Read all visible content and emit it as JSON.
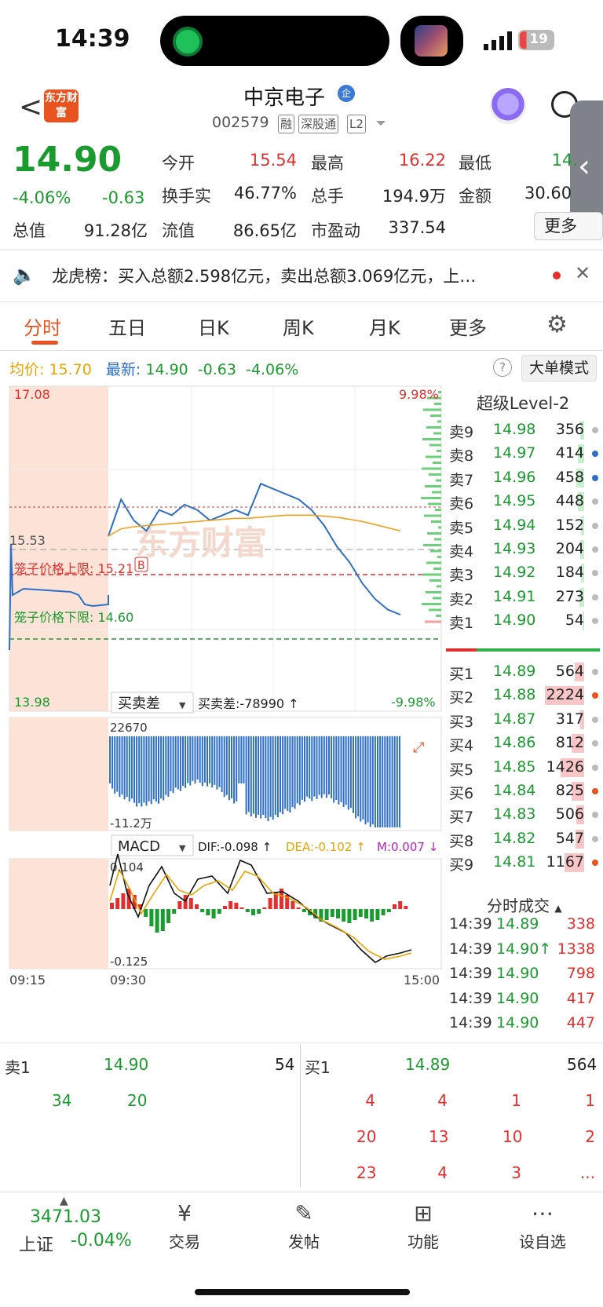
{
  "status_bar": {
    "time": "14:39",
    "battery": "19"
  },
  "header": {
    "back_label": "<",
    "logo_text": "东方财富",
    "stock_name": "中京电子",
    "qi_badge": "企",
    "stock_code": "002579",
    "tags": [
      "融",
      "深股通",
      "L2"
    ]
  },
  "quote": {
    "price": "14.90",
    "change_pct": "-4.06%",
    "change": "-0.63",
    "fields": [
      {
        "label": "今开",
        "value": "15.54",
        "color": "red"
      },
      {
        "label": "最高",
        "value": "16.22",
        "color": "red"
      },
      {
        "label": "最低",
        "value": "14.",
        "color": "green"
      },
      {
        "label": "换手实",
        "value": "46.77%",
        "color": "dark"
      },
      {
        "label": "总手",
        "value": "194.9万",
        "color": "dark"
      },
      {
        "label": "金额",
        "value": "30.60",
        "color": "dark"
      },
      {
        "label": "总值",
        "value": "91.28亿",
        "color": "dark"
      },
      {
        "label": "流值",
        "value": "86.65亿",
        "color": "dark"
      },
      {
        "label": "市盈动",
        "value": "337.54",
        "color": "dark"
      }
    ],
    "more_label": "更多"
  },
  "notice": {
    "text": "龙虎榜：买入总额2.598亿元，卖出总额3.069亿元，上…"
  },
  "tabs": [
    "分时",
    "五日",
    "日K",
    "周K",
    "月K",
    "更多"
  ],
  "info_line": {
    "avg_label": "均价:",
    "avg_value": "15.70",
    "latest_label": "最新:",
    "latest_value": "14.90",
    "change": "-0.63",
    "change_pct": "-4.06%",
    "mode_button": "大单模式"
  },
  "chart": {
    "y_high": "17.08",
    "y_low": "13.98",
    "y_mid": "15.53",
    "pct_high": "9.98%",
    "pct_low": "-9.98%",
    "upper_limit_label": "笼子价格上限: 15.21",
    "lower_limit_label": "笼子价格下限: 14.60",
    "marker": "B",
    "watermark": "东方财富",
    "buy_sell_diff_title": "买卖差",
    "buy_sell_diff_value": "买卖差:-78990 ↑",
    "diff_high": "22670",
    "diff_low": "-11.2万",
    "macd_title": "MACD",
    "dif": "DIF:-0.098 ↑",
    "dea": "DEA:-0.102 ↑",
    "m": "M:0.007 ↓",
    "macd_high": "0.104",
    "macd_low": "-0.125",
    "time_labels": [
      "09:15",
      "09:30",
      "15:00"
    ],
    "colors": {
      "price_line": "#2d6fc6",
      "avg_line": "#f0a020",
      "up": "#e52e2e",
      "down": "#1a9b2f"
    }
  },
  "chart_data": {
    "type": "line",
    "title": "",
    "ylim": [
      13.98,
      17.08
    ],
    "x": [
      "09:30",
      "15:00"
    ],
    "series": [
      {
        "name": "",
        "values": [
          15.65,
          16.0,
          15.8,
          15.7,
          15.9,
          15.85,
          15.95,
          15.9,
          15.8,
          15.85,
          15.9,
          15.85,
          16.15,
          16.1,
          16.05,
          16.0,
          15.9,
          15.75,
          15.55,
          15.4,
          15.2,
          15.05,
          14.95,
          14.9
        ]
      },
      {
        "name": "",
        "values": [
          15.65,
          15.72,
          15.74,
          15.75,
          15.76,
          15.77,
          15.78,
          15.79,
          15.8,
          15.81,
          15.82,
          15.82,
          15.83,
          15.84,
          15.85,
          15.85,
          15.85,
          15.84,
          15.83,
          15.81,
          15.79,
          15.76,
          15.73,
          15.7
        ]
      }
    ]
  },
  "level2": {
    "title": "超级Level-2",
    "asks": [
      {
        "label": "卖9",
        "price": "14.98",
        "vol": "356",
        "bar": 0.05,
        "dot": "#bbb"
      },
      {
        "label": "卖8",
        "price": "14.97",
        "vol": "414",
        "bar": 0.08,
        "dot": "#2d6fc6"
      },
      {
        "label": "卖7",
        "price": "14.96",
        "vol": "458",
        "bar": 0.1,
        "dot": "#2d6fc6"
      },
      {
        "label": "卖6",
        "price": "14.95",
        "vol": "448",
        "bar": 0.08,
        "dot": "#bbb"
      },
      {
        "label": "卖5",
        "price": "14.94",
        "vol": "152",
        "bar": 0.04,
        "dot": "#bbb"
      },
      {
        "label": "卖4",
        "price": "14.93",
        "vol": "204",
        "bar": 0.05,
        "dot": "#bbb"
      },
      {
        "label": "卖3",
        "price": "14.92",
        "vol": "184",
        "bar": 0.04,
        "dot": "#bbb"
      },
      {
        "label": "卖2",
        "price": "14.91",
        "vol": "273",
        "bar": 0.06,
        "dot": "#bbb"
      },
      {
        "label": "卖1",
        "price": "14.90",
        "vol": "54",
        "bar": 0.02,
        "dot": "#bbb"
      }
    ],
    "bids": [
      {
        "label": "买1",
        "price": "14.89",
        "vol": "564",
        "bar": 0.12,
        "dot": "#bbb"
      },
      {
        "label": "买2",
        "price": "14.88",
        "vol": "2224",
        "bar": 0.5,
        "dot": "#e8531f"
      },
      {
        "label": "买3",
        "price": "14.87",
        "vol": "317",
        "bar": 0.05,
        "dot": "#bbb"
      },
      {
        "label": "买4",
        "price": "14.86",
        "vol": "812",
        "bar": 0.16,
        "dot": "#bbb"
      },
      {
        "label": "买5",
        "price": "14.85",
        "vol": "1426",
        "bar": 0.3,
        "dot": "#bbb"
      },
      {
        "label": "买6",
        "price": "14.84",
        "vol": "825",
        "bar": 0.16,
        "dot": "#e8531f"
      },
      {
        "label": "买7",
        "price": "14.83",
        "vol": "506",
        "bar": 0.1,
        "dot": "#bbb"
      },
      {
        "label": "买8",
        "price": "14.82",
        "vol": "547",
        "bar": 0.11,
        "dot": "#bbb"
      },
      {
        "label": "买9",
        "price": "14.81",
        "vol": "1167",
        "bar": 0.25,
        "dot": "#e8531f"
      }
    ],
    "ticks_title": "分时成交",
    "ticks": [
      {
        "time": "14:39",
        "price": "14.89",
        "vol": "338",
        "color": "green"
      },
      {
        "time": "14:39",
        "price": "14.90↑",
        "vol": "1338",
        "color": "red"
      },
      {
        "time": "14:39",
        "price": "14.90",
        "vol": "798",
        "color": "green"
      },
      {
        "time": "14:39",
        "price": "14.90",
        "vol": "417",
        "color": "green"
      },
      {
        "time": "14:39",
        "price": "14.90",
        "vol": "447",
        "color": "green"
      }
    ]
  },
  "queue": {
    "sell1_label": "卖1",
    "sell1_price": "14.90",
    "sell1_vol": "54",
    "buy1_label": "买1",
    "buy1_price": "14.89",
    "buy1_vol": "564",
    "sell_orders": [
      "34",
      "20"
    ],
    "buy_orders": [
      "4",
      "4",
      "1",
      "1",
      "20",
      "13",
      "10",
      "2",
      "23",
      "4",
      "3",
      "..."
    ]
  },
  "nav": {
    "index_value": "3471.03",
    "index_name": "上证",
    "index_change": "-0.04%",
    "items": [
      {
        "label": "交易",
        "icon": "¥"
      },
      {
        "label": "发帖",
        "icon": "✎"
      },
      {
        "label": "功能",
        "icon": "⊞"
      },
      {
        "label": "设自选",
        "icon": "⋯"
      }
    ]
  }
}
